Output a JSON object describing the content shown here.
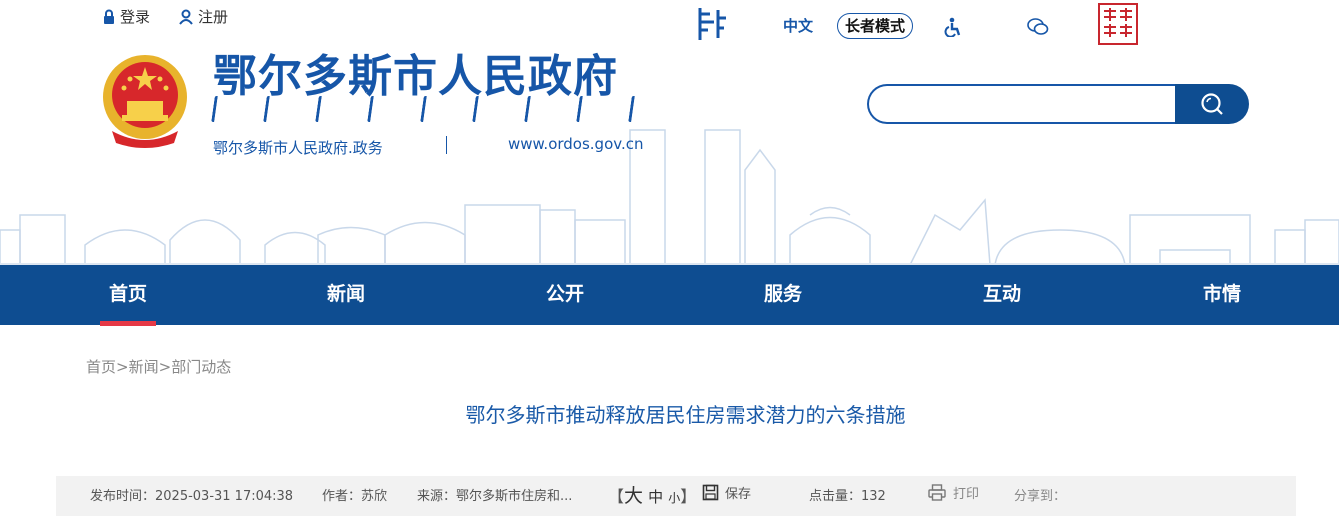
{
  "top_links": {
    "login": "登录",
    "register": "注册"
  },
  "site": {
    "title": "鄂尔多斯市人民政府",
    "subtitle": "鄂尔多斯市人民政府.政务",
    "url": "www.ordos.gov.cn",
    "brand_color": "#1656a8"
  },
  "utility": {
    "chinese": "中文",
    "elder_mode": "长者模式",
    "icons": [
      "mongolian-script-icon",
      "accessibility-icon",
      "wechat-icon",
      "ordos-online-seal-icon"
    ]
  },
  "search": {
    "placeholder": ""
  },
  "nav": {
    "items": [
      {
        "label": "首页",
        "active": true
      },
      {
        "label": "新闻"
      },
      {
        "label": "公开"
      },
      {
        "label": "服务"
      },
      {
        "label": "互动"
      },
      {
        "label": "市情"
      }
    ],
    "bg_color": "#0e4d91",
    "active_color": "#e63946"
  },
  "breadcrumb": {
    "home": "首页",
    "sep": ">",
    "news": "新闻",
    "current": "部门动态"
  },
  "article": {
    "title": "鄂尔多斯市推动释放居民住房需求潜力的六条措施",
    "publish_time": "发布时间：2025-03-31 17:04:38",
    "author": "作者：苏欣",
    "source": "来源：鄂尔多斯市住房和...",
    "font_bracket_left": "【",
    "font_large": "大",
    "font_medium": "中",
    "font_small": "小",
    "font_bracket_right": "】",
    "save": "保存",
    "hits_label": "点击量：",
    "hits": "132",
    "print": "打印",
    "share": "分享到："
  }
}
